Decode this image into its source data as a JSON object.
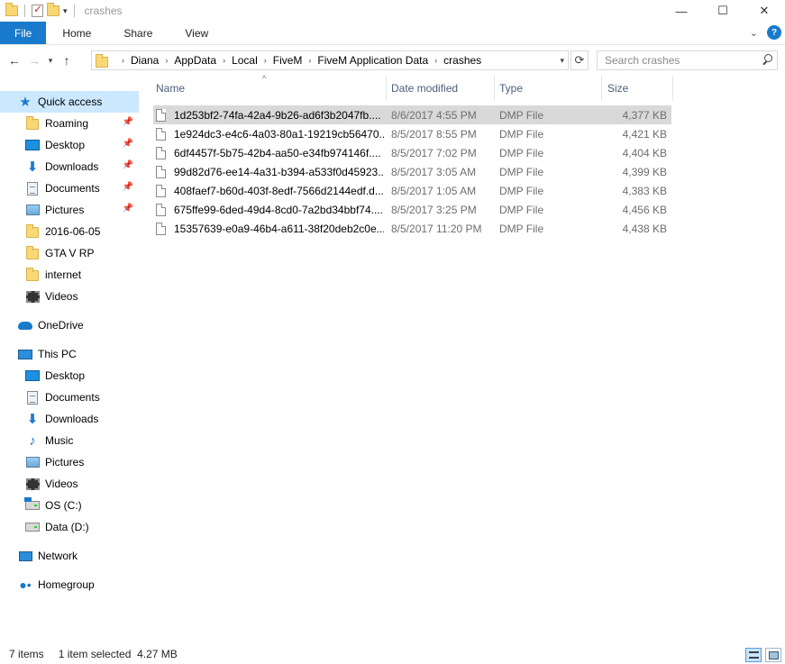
{
  "window": {
    "title": "crashes",
    "controls": [
      "—",
      "☐",
      "✕"
    ]
  },
  "ribbon": {
    "tabs": [
      "File",
      "Home",
      "Share",
      "View"
    ],
    "expand_glyph": "⌄",
    "help_glyph": "?"
  },
  "address": {
    "crumbs": [
      "Diana",
      "AppData",
      "Local",
      "FiveM",
      "FiveM Application Data",
      "crashes"
    ],
    "search_placeholder": "Search crashes"
  },
  "sidebar": {
    "quick_access": "Quick access",
    "pinned": [
      "Roaming",
      "Desktop",
      "Downloads",
      "Documents",
      "Pictures"
    ],
    "recent": [
      "2016-06-05",
      "GTA V RP",
      "internet",
      "Videos"
    ],
    "onedrive": "OneDrive",
    "this_pc": "This PC",
    "pc_items": [
      "Desktop",
      "Documents",
      "Downloads",
      "Music",
      "Pictures",
      "Videos",
      "OS (C:)",
      "Data (D:)"
    ],
    "network": "Network",
    "homegroup": "Homegroup"
  },
  "columns": {
    "name": "Name",
    "date": "Date modified",
    "type": "Type",
    "size": "Size"
  },
  "files": [
    {
      "name": "1d253bf2-74fa-42a4-9b26-ad6f3b2047fb....",
      "date": "8/6/2017 4:55 PM",
      "type": "DMP File",
      "size": "4,377 KB"
    },
    {
      "name": "1e924dc3-e4c6-4a03-80a1-19219cb56470....",
      "date": "8/5/2017 8:55 PM",
      "type": "DMP File",
      "size": "4,421 KB"
    },
    {
      "name": "6df4457f-5b75-42b4-aa50-e34fb974146f....",
      "date": "8/5/2017 7:02 PM",
      "type": "DMP File",
      "size": "4,404 KB"
    },
    {
      "name": "99d82d76-ee14-4a31-b394-a533f0d45923....",
      "date": "8/5/2017 3:05 AM",
      "type": "DMP File",
      "size": "4,399 KB"
    },
    {
      "name": "408faef7-b60d-403f-8edf-7566d2144edf.d...",
      "date": "8/5/2017 1:05 AM",
      "type": "DMP File",
      "size": "4,383 KB"
    },
    {
      "name": "675ffe99-6ded-49d4-8cd0-7a2bd34bbf74....",
      "date": "8/5/2017 3:25 PM",
      "type": "DMP File",
      "size": "4,456 KB"
    },
    {
      "name": "15357639-e0a9-46b4-a611-38f20deb2c0e....",
      "date": "8/5/2017 11:20 PM",
      "type": "DMP File",
      "size": "4,438 KB"
    }
  ],
  "status": {
    "count": "7 items",
    "selection": "1 item selected  4.27 MB"
  },
  "colors": {
    "accent": "#1979ca",
    "selection_nav": "#cce8ff",
    "selection_row": "#d9d9d9"
  }
}
